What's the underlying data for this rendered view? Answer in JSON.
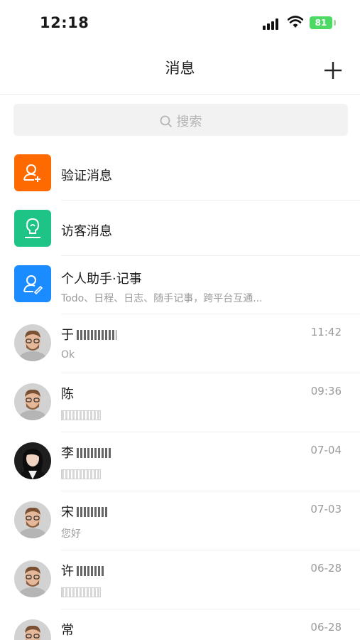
{
  "status_bar": {
    "time": "12:18",
    "battery": "81"
  },
  "nav": {
    "title": "消息",
    "add_icon": "plus-icon"
  },
  "search": {
    "placeholder": "搜索",
    "icon": "search-icon"
  },
  "system_items": [
    {
      "title": "验证消息",
      "subtitle": "",
      "color": "#ff6a00",
      "icon": "add-user-icon"
    },
    {
      "title": "访客消息",
      "subtitle": "",
      "color": "#1dc486",
      "icon": "visitor-icon"
    },
    {
      "title": "个人助手·记事",
      "subtitle": "Todo、日程、日志、随手记事，跨平台互通...",
      "color": "#1a8cff",
      "icon": "assistant-icon"
    }
  ],
  "chats": [
    {
      "name": "于",
      "message": "Ok",
      "time": "11:42",
      "avatar": "man-avatar"
    },
    {
      "name": "陈",
      "message": "",
      "time": "09:36",
      "avatar": "man-avatar"
    },
    {
      "name": "李",
      "message": "",
      "time": "07-04",
      "avatar": "woman-avatar"
    },
    {
      "name": "宋",
      "message": "您好",
      "time": "07-03",
      "avatar": "man-avatar"
    },
    {
      "name": "许",
      "message": "",
      "time": "06-28",
      "avatar": "man-avatar"
    },
    {
      "name": "常",
      "message": "",
      "time": "06-28",
      "avatar": "man-avatar"
    }
  ]
}
